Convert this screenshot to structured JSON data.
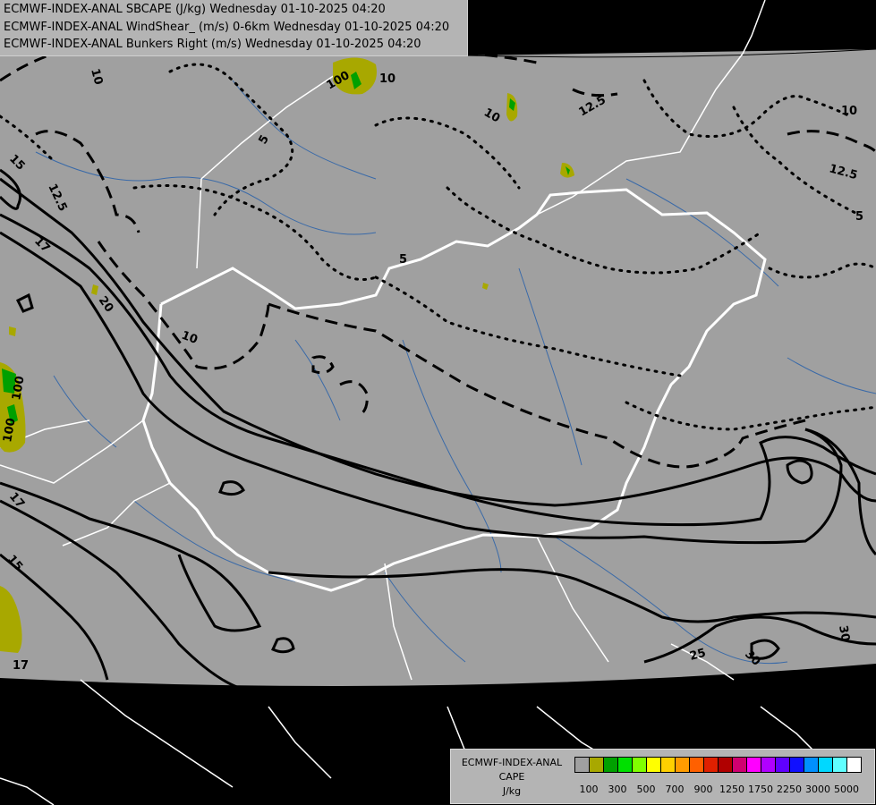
{
  "header": {
    "lines": [
      "ECMWF-INDEX-ANAL SBCAPE (J/kg) Wednesday 01-10-2025 04:20",
      "ECMWF-INDEX-ANAL WindShear_ (m/s) 0-6km Wednesday 01-10-2025 04:20",
      "ECMWF-INDEX-ANAL Bunkers Right (m/s) Wednesday 01-10-2025 04:20"
    ]
  },
  "legend": {
    "title_lines": [
      "ECMWF-INDEX-ANAL",
      "CAPE",
      "J/kg"
    ],
    "colors": [
      "#a0a0a0",
      "#a8a800",
      "#00a000",
      "#00e000",
      "#80ff00",
      "#ffff00",
      "#ffd000",
      "#ff9c00",
      "#ff6000",
      "#e02000",
      "#b00000",
      "#d00070",
      "#ff00ff",
      "#b000ff",
      "#6000ff",
      "#1010ff",
      "#0090ff",
      "#00d8ff",
      "#60ffff",
      "#ffffff"
    ],
    "tick_labels": [
      "100",
      "300",
      "500",
      "700",
      "900",
      "1250",
      "1750",
      "2250",
      "3000",
      "5000"
    ]
  },
  "contour_labels": {
    "cape": [
      "100",
      "100",
      "100"
    ],
    "shear": [
      "15",
      "17",
      "20",
      "17",
      "15",
      "17",
      "25",
      "30",
      "30"
    ],
    "bunkers": [
      "10",
      "10",
      "12.5",
      "12.5",
      "10",
      "12.5",
      "5",
      "5",
      "10",
      "10",
      "5"
    ]
  },
  "map": {
    "land_color": "#a0a0a0",
    "background_color": "#000000",
    "border_color": "#ffffff",
    "river_color": "#3a6aa8"
  }
}
